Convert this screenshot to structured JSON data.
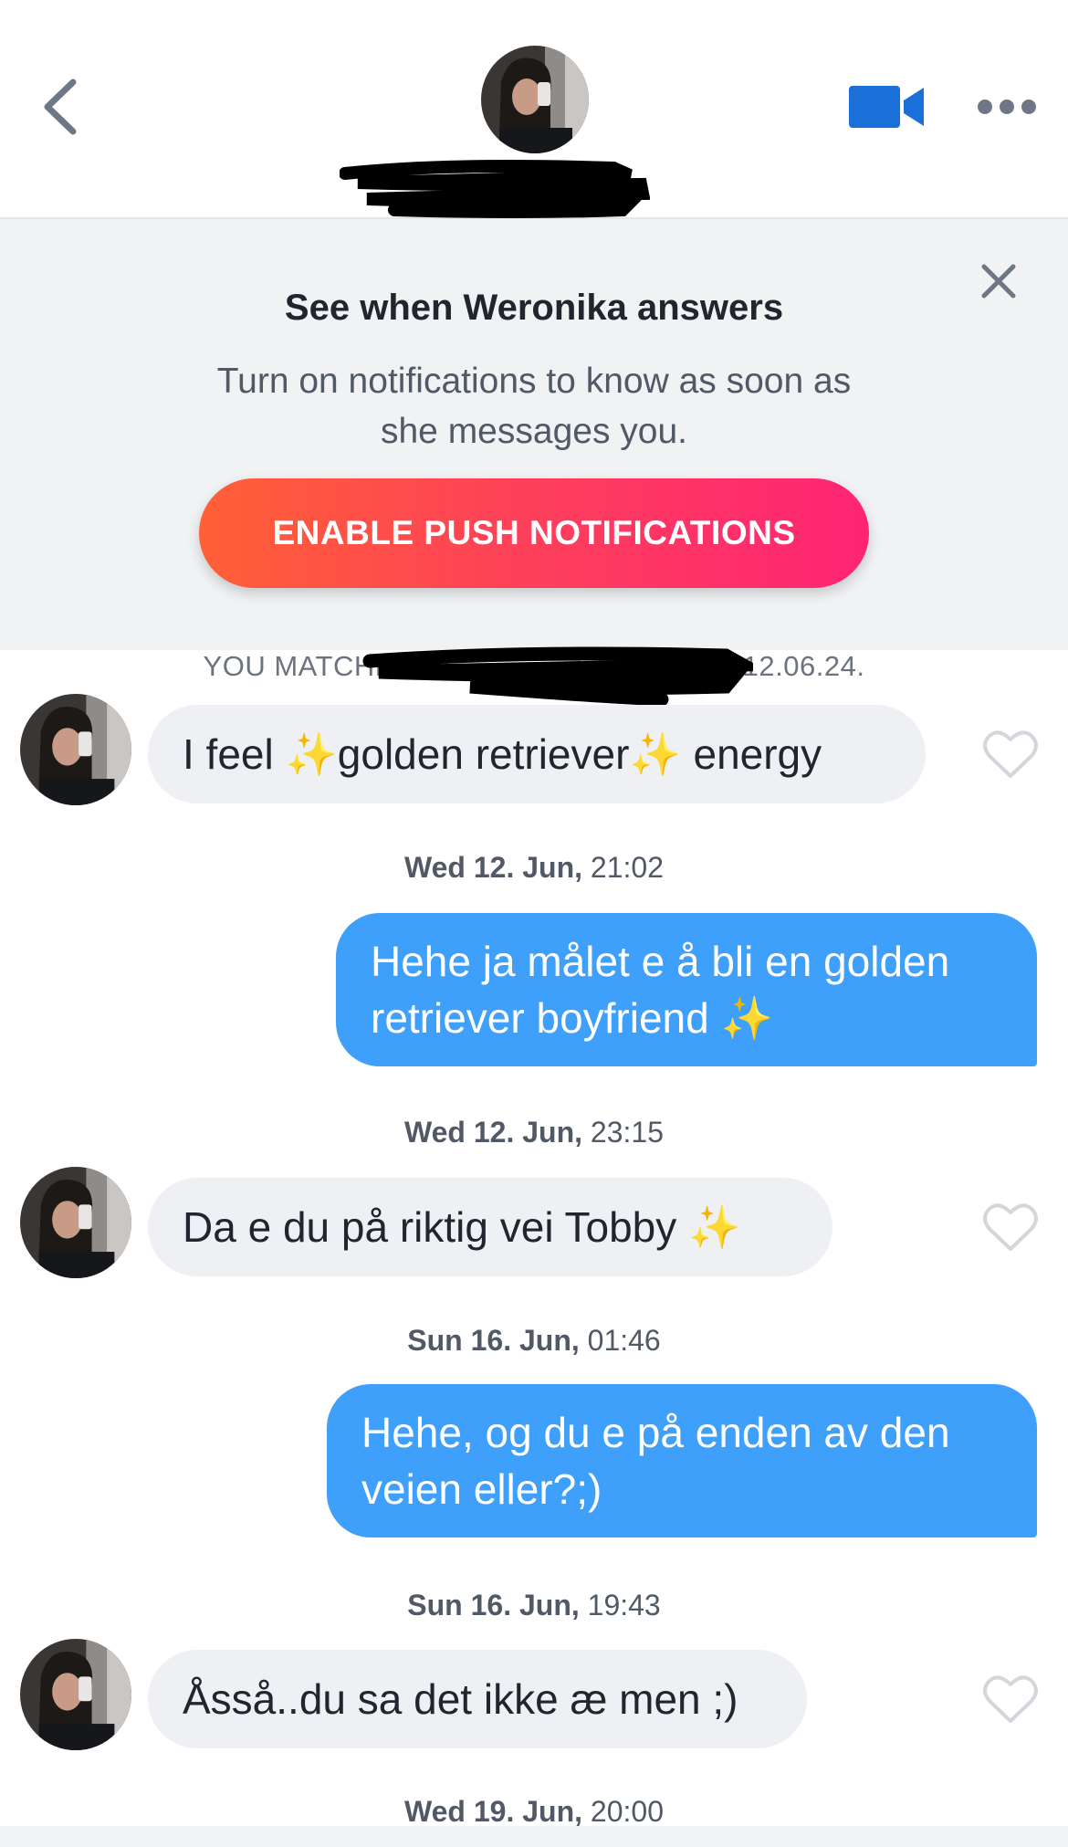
{
  "header": {
    "back_icon": "chevron-left-icon",
    "video_icon": "video-camera-icon",
    "more_icon": "more-horizontal-icon",
    "accent_color": "#1a6fd9"
  },
  "banner": {
    "title": "See when Weronika answers",
    "text": "Turn on notifications to know as soon as she messages you.",
    "button_label": "ENABLE PUSH NOTIFICATIONS",
    "close_icon": "close-icon",
    "gradient": [
      "#ff6036",
      "#fe2474"
    ]
  },
  "match_line": {
    "prefix": "YOU MATCHED W",
    "suffix": "12.06.24."
  },
  "messages": [
    {
      "type": "timestamp",
      "day": "",
      "time": ""
    },
    {
      "type": "incoming",
      "parts": [
        "I feel ",
        "✨",
        "golden retriever",
        "✨",
        " energy"
      ]
    },
    {
      "type": "timestamp",
      "day": "Wed 12. Jun,",
      "time": "21:02"
    },
    {
      "type": "outgoing",
      "line1": "Hehe ja målet e å bli en golden",
      "line2": "retriever boyfriend ",
      "sparkle": "✨"
    },
    {
      "type": "timestamp",
      "day": "Wed 12. Jun,",
      "time": "23:15"
    },
    {
      "type": "incoming",
      "text": "Da e du på riktig vei Tobby ",
      "sparkle": "✨"
    },
    {
      "type": "timestamp",
      "day": "Sun 16. Jun,",
      "time": "01:46"
    },
    {
      "type": "outgoing",
      "line1": "Hehe, og du e på enden av den",
      "line2": "veien eller?;)"
    },
    {
      "type": "timestamp",
      "day": "Sun 16. Jun,",
      "time": "19:43"
    },
    {
      "type": "incoming",
      "text": "Åsså..du sa det ikke æ men ;)"
    },
    {
      "type": "timestamp",
      "day": "Wed 19. Jun,",
      "time": "20:00"
    }
  ],
  "bubble_colors": {
    "incoming": "#eef0f3",
    "outgoing": "#3fa0fb"
  }
}
